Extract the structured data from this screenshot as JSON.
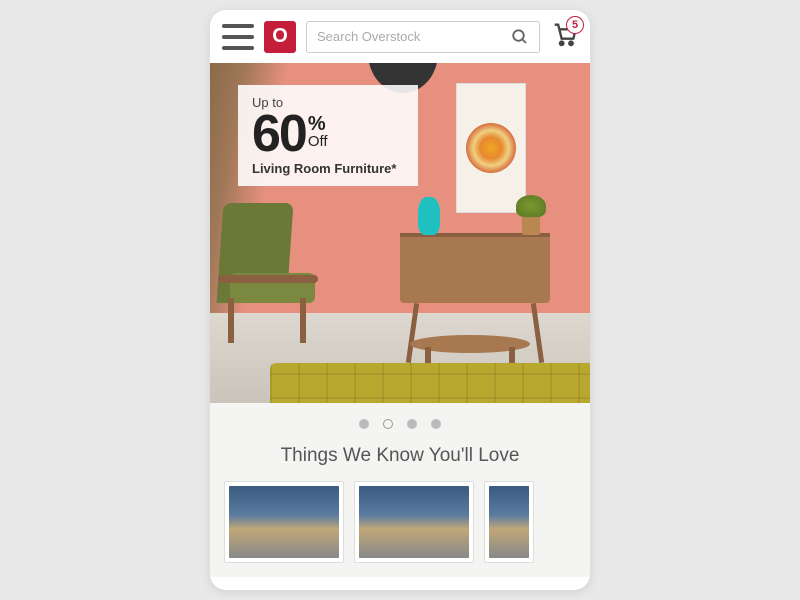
{
  "header": {
    "logo_letter": "O",
    "search_placeholder": "Search Overstock",
    "cart_count": "5"
  },
  "hero": {
    "promo": {
      "upto": "Up to",
      "number": "60",
      "pct": "%",
      "off": "Off",
      "category": "Living Room Furniture*"
    },
    "carousel": {
      "total": 4,
      "active_index": 1
    }
  },
  "section_title": "Things We Know You'll Love"
}
